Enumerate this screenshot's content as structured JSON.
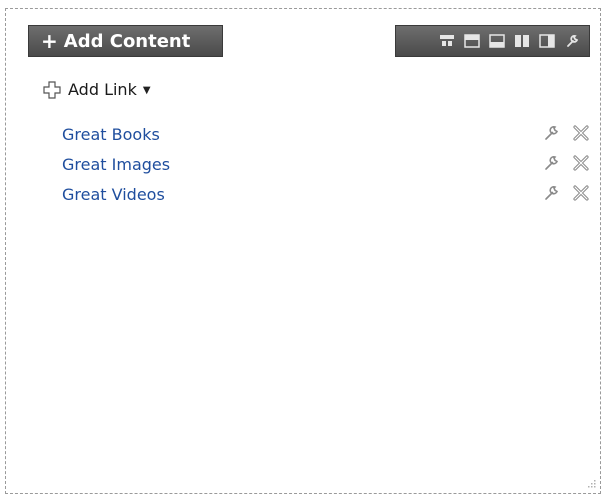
{
  "add_content_button": {
    "label": "Add Content",
    "plus": "+"
  },
  "toolbar": {
    "icons": [
      "layout-move-icon",
      "layout-top-icon",
      "layout-bottom-icon",
      "layout-columns-icon",
      "layout-single-icon",
      "wrench-icon"
    ]
  },
  "add_link": {
    "label": "Add Link",
    "caret": "▼"
  },
  "links": [
    {
      "label": "Great Books"
    },
    {
      "label": "Great Images"
    },
    {
      "label": "Great Videos"
    }
  ],
  "colors": {
    "button_bg": "#5a5a5a",
    "link": "#1f4e9e",
    "icon_gray": "#9a9a9a"
  }
}
